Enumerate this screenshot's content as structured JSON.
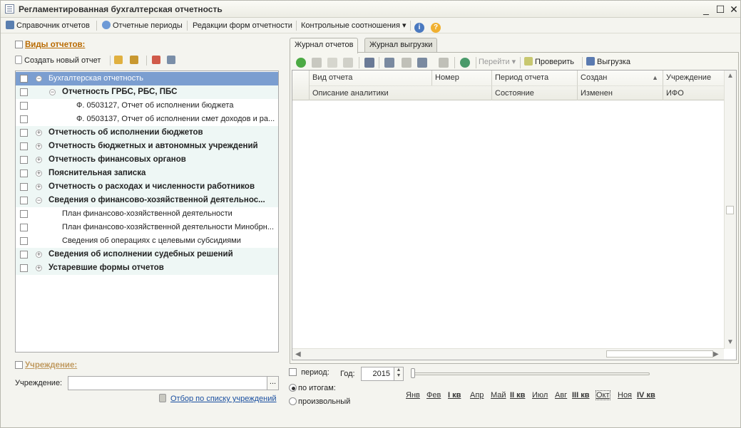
{
  "window": {
    "title": "Регламентированная бухгалтерская отчетность",
    "minimize": "_",
    "maximize": "☐",
    "close": "✕"
  },
  "menu": {
    "items": [
      {
        "label": "Справочник отчетов",
        "icon": "directory-icon"
      },
      {
        "label": "Отчетные периоды",
        "icon": "clock-icon"
      },
      {
        "label": "Редакции форм отчетности",
        "icon": ""
      },
      {
        "label": "Контрольные соотношения ▾",
        "icon": ""
      }
    ],
    "info_icon": "info-icon",
    "help_icon": "help-icon"
  },
  "left": {
    "report_types_label": "Виды отчетов:",
    "create_label": "Создать новый отчет",
    "tree": [
      {
        "label": "Бухгалтерская отчетность",
        "level": 0,
        "expanded": true,
        "selected": true,
        "group": true
      },
      {
        "label": "Отчетность ГРБС, РБС, ПБС",
        "level": 1,
        "expanded": true,
        "group": true
      },
      {
        "label": "Ф. 0503127, Отчет об исполнении бюджета",
        "level": 2
      },
      {
        "label": "Ф. 0503137, Отчет об исполнении смет доходов и ра...",
        "level": 2
      },
      {
        "label": "Отчетность об исполнении бюджетов",
        "level": 0,
        "group": true
      },
      {
        "label": "Отчетность бюджетных и автономных учреждений",
        "level": 0,
        "group": true
      },
      {
        "label": "Отчетность финансовых органов",
        "level": 0,
        "group": true
      },
      {
        "label": "Пояснительная записка",
        "level": 0,
        "group": true
      },
      {
        "label": "Отчетность о расходах и численности работников",
        "level": 0,
        "group": true
      },
      {
        "label": "Сведения о финансово-хозяйственной деятельнос...",
        "level": 0,
        "expanded": true,
        "group": true
      },
      {
        "label": "План финансово-хозяйственной деятельности",
        "level": 1
      },
      {
        "label": "План финансово-хозяйственной деятельности Минобрн...",
        "level": 1
      },
      {
        "label": "Сведения об операциях с целевыми субсидиями",
        "level": 1
      },
      {
        "label": "Сведения об исполнении судебных решений",
        "level": 0,
        "group": true
      },
      {
        "label": "Устаревшие формы отчетов",
        "level": 0,
        "group": true
      }
    ],
    "institution_header": "Учреждение:",
    "institution_label": "Учреждение:",
    "institution_value": "",
    "institution_btn": "...",
    "filter_link": "Отбор по списку учреждений"
  },
  "right": {
    "tabs": [
      "Журнал отчетов",
      "Журнал выгрузки"
    ],
    "toolbar": {
      "goto": "Перейти ▾",
      "check": "Проверить",
      "export": "Выгрузка"
    },
    "columns_row1": [
      "Вид отчета",
      "Номер",
      "Период отчета",
      "Создан",
      "Учреждение"
    ],
    "columns_row2": [
      "Описание аналитики",
      "",
      "Состояние",
      "Изменен",
      "ИФО"
    ]
  },
  "period": {
    "period_label": "период:",
    "year_label": "Год:",
    "year_value": "2015",
    "opt_totals": "по итогам:",
    "opt_custom": "произвольный",
    "months": [
      {
        "label": "Янв",
        "q": false
      },
      {
        "label": "Фев",
        "q": false
      },
      {
        "label": "I кв",
        "q": true
      },
      {
        "label": "Апр",
        "q": false
      },
      {
        "label": "Май",
        "q": false
      },
      {
        "label": "II кв",
        "q": true
      },
      {
        "label": "Июл",
        "q": false
      },
      {
        "label": "Авг",
        "q": false
      },
      {
        "label": "III кв",
        "q": true
      },
      {
        "label": "Окт",
        "q": false,
        "current": true
      },
      {
        "label": "Ноя",
        "q": false
      },
      {
        "label": "IV кв",
        "q": true
      }
    ]
  },
  "colors": {
    "accent": "#b96a00",
    "selection": "#7b9ed0",
    "link": "#1a4fa0",
    "group_bg": "#eef7f5"
  }
}
